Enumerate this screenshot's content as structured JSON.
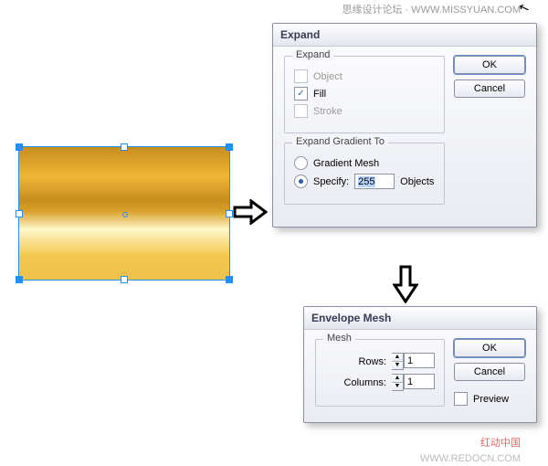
{
  "watermarks": {
    "top": "思缘设计论坛 · WWW.MISSYUAN.COM",
    "bottom1": "红动中国",
    "bottom2": "WWW.REDOCN.COM"
  },
  "dialog1": {
    "title": "Expand",
    "group1_title": "Expand",
    "opt_object": "Object",
    "opt_fill": "Fill",
    "opt_stroke": "Stroke",
    "group2_title": "Expand Gradient To",
    "opt_gradmesh": "Gradient Mesh",
    "opt_specify": "Specify:",
    "specify_value": "255",
    "specify_suffix": "Objects",
    "ok": "OK",
    "cancel": "Cancel"
  },
  "dialog2": {
    "title": "Envelope Mesh",
    "group_title": "Mesh",
    "rows_label": "Rows:",
    "rows_value": "1",
    "cols_label": "Columns:",
    "cols_value": "1",
    "ok": "OK",
    "cancel": "Cancel",
    "preview": "Preview"
  }
}
